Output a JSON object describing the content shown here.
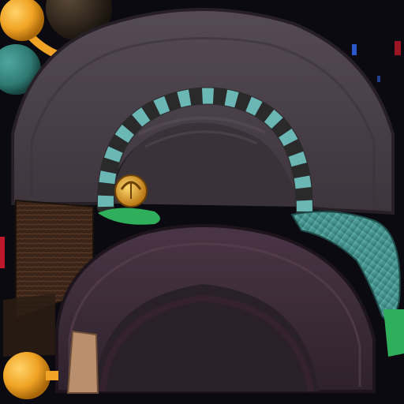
{
  "texture_atlas": {
    "background_color": "#0b0a10",
    "palette": {
      "upper_hood": "#4a4049",
      "upper_hood_shadow": "#2d272e",
      "upper_hood_inner": "#3a3239",
      "lower_hood": "#3d2b39",
      "lower_hood_inner": "#2a2128",
      "ring_dark": "#2a2a2a",
      "ring_teal": "#6ab7b6",
      "bolt_gold": "#e2a226",
      "leaf_green": "#2fae5b",
      "brush_teal": "#3f8f8f",
      "bark_brown": "#3a2418",
      "bead_orange": "#f0a324",
      "bead_teal": "#2f7a73",
      "bead_dark": "#2a221b",
      "patch_tan": "#b98f6d",
      "accent_red": "#c0182a",
      "accent_blue": "#2b58c8"
    },
    "parts": [
      {
        "name": "upper-hood-panel"
      },
      {
        "name": "striped-ring"
      },
      {
        "name": "gold-bolt"
      },
      {
        "name": "green-leaf"
      },
      {
        "name": "teal-brush-tail"
      },
      {
        "name": "bark-strip"
      },
      {
        "name": "lower-hood-panel"
      },
      {
        "name": "tan-patch"
      },
      {
        "name": "orange-bead"
      },
      {
        "name": "teal-bead"
      },
      {
        "name": "dark-bead"
      }
    ]
  }
}
